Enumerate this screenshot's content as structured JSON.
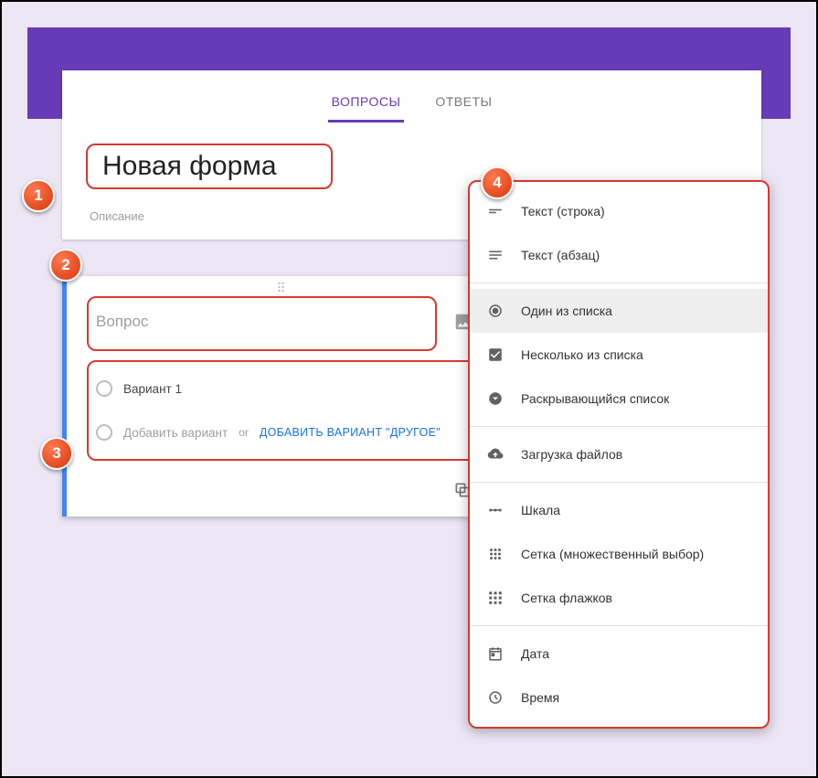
{
  "tabs": {
    "questions": "ВОПРОСЫ",
    "responses": "ОТВЕТЫ"
  },
  "form": {
    "title": "Новая форма",
    "description_placeholder": "Описание"
  },
  "question": {
    "placeholder": "Вопрос",
    "option1": "Вариант 1",
    "add_option": "Добавить вариант",
    "or": "or",
    "add_other": "ДОБАВИТЬ ВАРИАНТ \"ДРУГОЕ\""
  },
  "type_menu": {
    "short_text": "Текст (строка)",
    "paragraph": "Текст (абзац)",
    "radio": "Один из списка",
    "checkbox": "Несколько из списка",
    "dropdown": "Раскрывающийся список",
    "upload": "Загрузка файлов",
    "scale": "Шкала",
    "grid_radio": "Сетка (множественный выбор)",
    "grid_check": "Сетка флажков",
    "date": "Дата",
    "time": "Время"
  },
  "badges": {
    "b1": "1",
    "b2": "2",
    "b3": "3",
    "b4": "4"
  }
}
